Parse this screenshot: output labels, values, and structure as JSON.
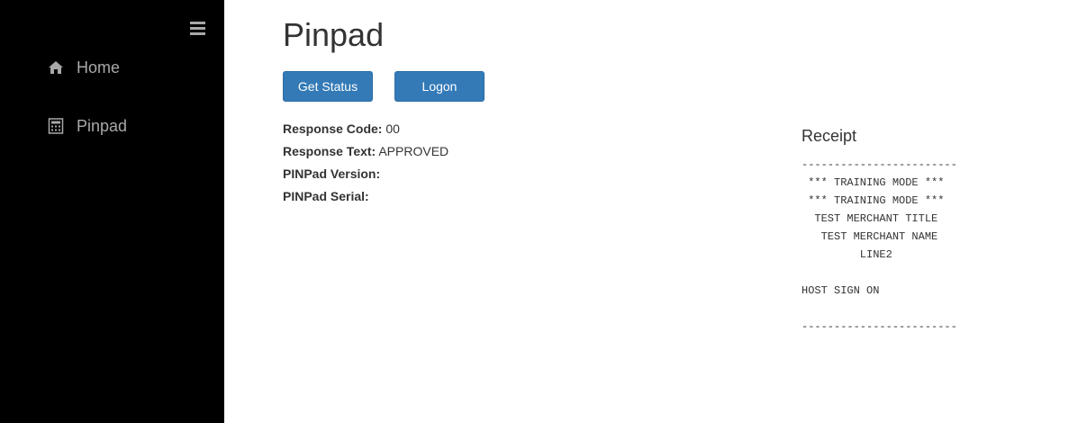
{
  "sidebar": {
    "menu_icon": "hamburger-menu-icon",
    "items": [
      {
        "label": "Home",
        "icon": "home-icon"
      },
      {
        "label": "Pinpad",
        "icon": "calculator-icon"
      }
    ],
    "background": "#000000",
    "text_color": "#a8a8a8"
  },
  "main": {
    "title": "Pinpad",
    "buttons": {
      "get_status": "Get Status",
      "logon": "Logon"
    },
    "button_color": "#337ab7",
    "fields": [
      {
        "label": "Response Code:",
        "value": "00"
      },
      {
        "label": "Response Text:",
        "value": "APPROVED"
      },
      {
        "label": "PINPad Version:",
        "value": ""
      },
      {
        "label": "PINPad Serial:",
        "value": ""
      }
    ]
  },
  "receipt": {
    "title": "Receipt",
    "text": "------------------------\n *** TRAINING MODE ***\n *** TRAINING MODE ***\n  TEST MERCHANT TITLE\n   TEST MERCHANT NAME\n         LINE2\n\nHOST SIGN ON\n\n------------------------"
  }
}
